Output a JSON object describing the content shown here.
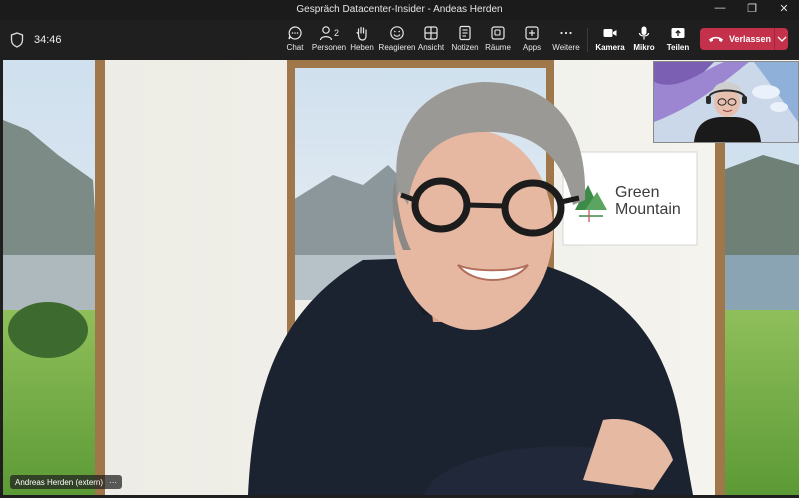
{
  "window": {
    "title": "Gespräch Datacenter-Insider - Andeas Herden"
  },
  "meeting": {
    "timer": "34:46"
  },
  "toolbar": {
    "chat": "Chat",
    "people": "Personen",
    "people_count": "2",
    "raise": "Heben",
    "react": "Reagieren",
    "view": "Ansicht",
    "notes": "Notizen",
    "rooms": "Räume",
    "apps": "Apps",
    "more": "Weitere",
    "camera": "Kamera",
    "mic": "Mikro",
    "share": "Teilen",
    "leave": "Verlassen"
  },
  "video": {
    "participant_name": "Andreas Herden (extern)",
    "more_glyph": "···",
    "background_logo": {
      "line1": "Green",
      "line2": "Mountain"
    }
  },
  "colors": {
    "leave_button": "#c4314b",
    "logo_text": "#3c3c3c",
    "logo_green": "#3e8a48"
  }
}
